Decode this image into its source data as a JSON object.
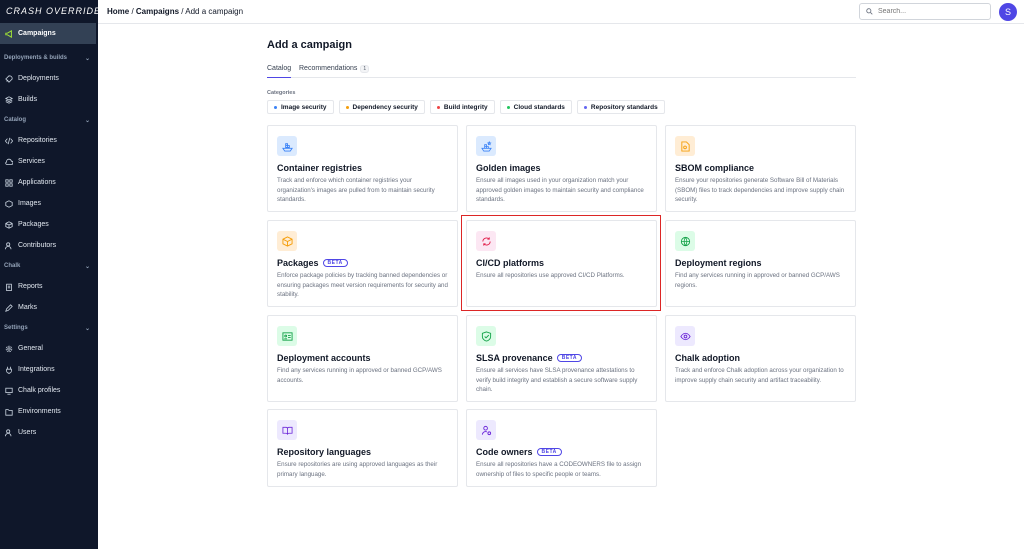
{
  "sidebar": {
    "logo": "CRASH OVERRIDE",
    "campaigns": "Campaigns",
    "sections": [
      {
        "label": "Deployments & builds",
        "items": [
          "Deployments",
          "Builds"
        ]
      },
      {
        "label": "Catalog",
        "items": [
          "Repositories",
          "Services",
          "Applications",
          "Images",
          "Packages",
          "Contributors"
        ]
      },
      {
        "label": "Chalk",
        "items": [
          "Reports",
          "Marks"
        ]
      },
      {
        "label": "Settings",
        "items": [
          "General",
          "Integrations",
          "Chalk profiles",
          "Environments",
          "Users"
        ]
      }
    ]
  },
  "topbar": {
    "breadcrumb": {
      "home": "Home",
      "sep1": " / ",
      "campaigns": "Campaigns",
      "sep2": " / ",
      "current": "Add a campaign"
    },
    "search_placeholder": "Search...",
    "avatar_initial": "S"
  },
  "main": {
    "title": "Add a campaign",
    "tabs": {
      "catalog": "Catalog",
      "recommendations": "Recommendations",
      "recommendations_count": "1"
    },
    "categories_label": "Categories",
    "chips": [
      {
        "label": "Image security",
        "color": "#3b82f6"
      },
      {
        "label": "Dependency security",
        "color": "#f59e0b"
      },
      {
        "label": "Build integrity",
        "color": "#ef4444"
      },
      {
        "label": "Cloud standards",
        "color": "#22c55e"
      },
      {
        "label": "Repository standards",
        "color": "#6366f1"
      }
    ],
    "cards": [
      {
        "title": "Container registries",
        "desc": "Track and enforce which container registries your organization's images are pulled from to maintain security standards.",
        "beta": ""
      },
      {
        "title": "Golden images",
        "desc": "Ensure all images used in your organization match your approved golden images to maintain security and compliance standards.",
        "beta": ""
      },
      {
        "title": "SBOM compliance",
        "desc": "Ensure your repositories generate Software Bill of Materials (SBOM) files to track dependencies and improve supply chain security.",
        "beta": ""
      },
      {
        "title": "Packages",
        "desc": "Enforce package policies by tracking banned dependencies or ensuring packages meet version requirements for security and stability.",
        "beta": "BETA"
      },
      {
        "title": "CI/CD platforms",
        "desc": "Ensure all repositories use approved CI/CD Platforms.",
        "beta": ""
      },
      {
        "title": "Deployment regions",
        "desc": "Find any services running in approved or banned GCP/AWS regions.",
        "beta": ""
      },
      {
        "title": "Deployment accounts",
        "desc": "Find any services running in approved or banned GCP/AWS accounts.",
        "beta": ""
      },
      {
        "title": "SLSA provenance",
        "desc": "Ensure all services have SLSA provenance attestations to verify build integrity and establish a secure software supply chain.",
        "beta": "BETA"
      },
      {
        "title": "Chalk adoption",
        "desc": "Track and enforce Chalk adoption across your organization to improve supply chain security and artifact traceability.",
        "beta": ""
      },
      {
        "title": "Repository languages",
        "desc": "Ensure repositories are using approved languages as their primary language.",
        "beta": ""
      },
      {
        "title": "Code owners",
        "desc": "Ensure all repositories have a CODEOWNERS file to assign ownership of files to specific people or teams.",
        "beta": "BETA"
      }
    ]
  }
}
